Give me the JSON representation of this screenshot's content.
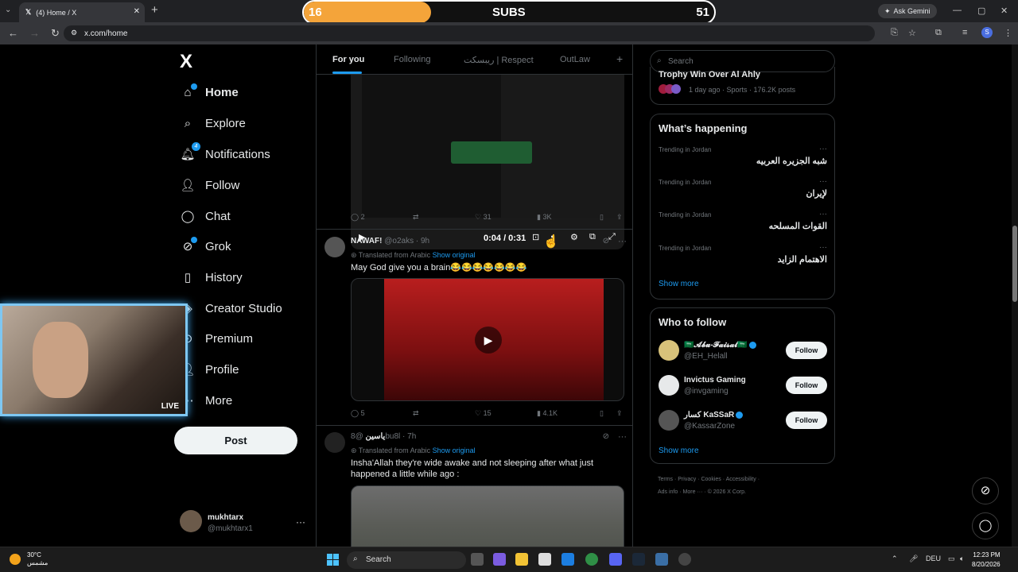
{
  "browser": {
    "tab_title": "(4) Home / X",
    "url": "x.com/home",
    "ask_gemini": "Ask Gemini",
    "profile_initial": "S"
  },
  "overlay": {
    "subs_label": "SUBS",
    "subs_current": "16",
    "subs_goal": "51",
    "subs_progress": 0.31,
    "live_label": "LIVE"
  },
  "sidebar": {
    "logo": "X",
    "items": [
      {
        "label": "Home",
        "icon": "home-icon"
      },
      {
        "label": "Explore",
        "icon": "search-icon"
      },
      {
        "label": "Notifications",
        "icon": "bell-icon",
        "badge": "4"
      },
      {
        "label": "Follow",
        "icon": "person-plus-icon"
      },
      {
        "label": "Chat",
        "icon": "chat-icon"
      },
      {
        "label": "Grok",
        "icon": "grok-icon"
      },
      {
        "label": "History",
        "icon": "bookmark-icon"
      },
      {
        "label": "Creator Studio",
        "icon": "creator-icon"
      },
      {
        "label": "Premium",
        "icon": "premium-icon"
      },
      {
        "label": "Profile",
        "icon": "person-icon"
      },
      {
        "label": "More",
        "icon": "more-icon"
      }
    ],
    "post_button": "Post",
    "account": {
      "name": "mukhtarx",
      "handle": "@mukhtarx1"
    }
  },
  "timeline": {
    "tabs": [
      "For you",
      "Following",
      "ريبسكت | Respect",
      "OutLaw"
    ],
    "video1": {
      "time": "0:04 / 0:31"
    },
    "post1_actions": {
      "replies": "2",
      "likes": "31",
      "views": "3K"
    },
    "post2": {
      "name": "NAWAF!",
      "handle": "@o2aks",
      "time": "9h",
      "translated": "Translated from Arabic",
      "show_original": "Show original",
      "text": "May God give you a brain😂😂😂😂😂😂😂",
      "actions": {
        "replies": "5",
        "likes": "15",
        "views": "4.1K"
      }
    },
    "post3": {
      "name": "ياسين",
      "handle": "@8bu8l",
      "time": "7h",
      "translated": "Translated from Arabic",
      "show_original": "Show original",
      "text": "Insha'Allah they're wide awake and not sleeping after what just happened a little while ago :"
    }
  },
  "right": {
    "search_placeholder": "Search",
    "top_story": {
      "title": "Trophy Win Over Al Ahly",
      "meta": "1 day ago · Sports · 176.2K posts"
    },
    "whats_happening": {
      "title": "What’s happening",
      "trends": [
        {
          "context": "Trending in Jordan",
          "name": "شبه الجزيره العربيه"
        },
        {
          "context": "Trending in Jordan",
          "name": "لإيران"
        },
        {
          "context": "Trending in Jordan",
          "name": "القوات المسلحه"
        },
        {
          "context": "Trending in Jordan",
          "name": "الاهتمام الزايد"
        }
      ],
      "show_more": "Show more"
    },
    "who_to_follow": {
      "title": "Who to follow",
      "accounts": [
        {
          "name": "🇸🇦𝓐𝓫𝓾-𝓕𝓪𝓲𝓼𝓪𝓵🇸🇦",
          "handle": "@EH_Helall",
          "button": "Follow"
        },
        {
          "name": "Invictus Gaming",
          "handle": "@invgaming",
          "button": "Follow"
        },
        {
          "name": "كسار KaSSaR",
          "handle": "@KassarZone",
          "button": "Follow"
        }
      ],
      "show_more": "Show more"
    },
    "footer": {
      "line1": [
        "Terms",
        "Privacy",
        "Cookies",
        "Accessibility"
      ],
      "line2": [
        "Ads info",
        "More ···",
        "© 2026 X Corp."
      ]
    }
  },
  "taskbar": {
    "temp": "30°C",
    "condition": "مشمس",
    "search": "Search",
    "lang": "DEU",
    "time": "12:23 PM",
    "date": "8/20/2026"
  }
}
